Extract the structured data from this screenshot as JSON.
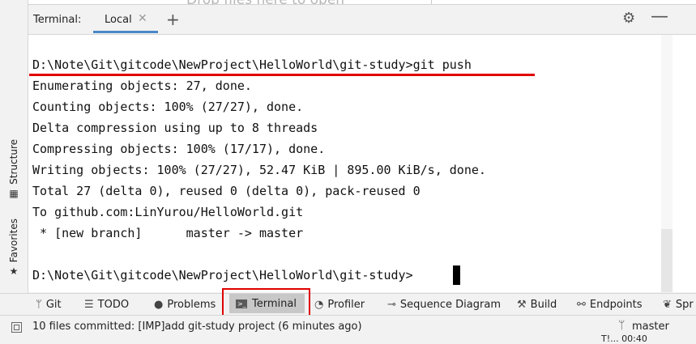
{
  "top": {
    "drop_hint": "Drop files here to open"
  },
  "left_strip": {
    "items": [
      {
        "label": "Structure",
        "icon": "structure-icon"
      },
      {
        "label": "Favorites",
        "icon": "star-icon"
      }
    ]
  },
  "terminal": {
    "title": "Terminal:",
    "tabs": [
      {
        "label": "Local",
        "active": true
      }
    ],
    "add_glyph": "+",
    "close_glyph": "✕",
    "gear_glyph": "⚙",
    "minimize_glyph": "—",
    "lines": [
      "",
      "D:\\Note\\Git\\gitcode\\NewProject\\HelloWorld\\git-study>git push",
      "Enumerating objects: 27, done.",
      "Counting objects: 100% (27/27), done.",
      "Delta compression using up to 8 threads",
      "Compressing objects: 100% (17/17), done.",
      "Writing objects: 100% (27/27), 52.47 KiB | 895.00 KiB/s, done.",
      "Total 27 (delta 0), reused 0 (delta 0), pack-reused 0",
      "To github.com:LinYurou/HelloWorld.git",
      " * [new branch]      master -> master",
      "",
      "D:\\Note\\Git\\gitcode\\NewProject\\HelloWorld\\git-study>"
    ],
    "accent_color": "#4a88c7",
    "highlight_color": "#e00000"
  },
  "toolbar": {
    "items": [
      {
        "id": "git",
        "label": "Git",
        "icon": "git-branch-icon",
        "glyph": "ᛘ"
      },
      {
        "id": "todo",
        "label": "TODO",
        "icon": "todo-list-icon",
        "glyph": "☰"
      },
      {
        "id": "problems",
        "label": "Problems",
        "icon": "problems-icon",
        "glyph": "●"
      },
      {
        "id": "terminal",
        "label": "Terminal",
        "icon": "terminal-icon",
        "glyph": ">_"
      },
      {
        "id": "profiler",
        "label": "Profiler",
        "icon": "profiler-icon",
        "glyph": "◔"
      },
      {
        "id": "sequence",
        "label": "Sequence Diagram",
        "icon": "sequence-diagram-icon",
        "glyph": "⊸"
      },
      {
        "id": "build",
        "label": "Build",
        "icon": "build-hammer-icon",
        "glyph": "⚒"
      },
      {
        "id": "endpoints",
        "label": "Endpoints",
        "icon": "endpoints-icon",
        "glyph": "⚯"
      },
      {
        "id": "spring",
        "label": "Spr",
        "icon": "spring-leaf-icon",
        "glyph": "❦"
      }
    ]
  },
  "status": {
    "message": "10 files committed: [IMP]add git-study project (6 minutes ago)",
    "branch": "master",
    "cut_text": "T!... 00:40"
  }
}
